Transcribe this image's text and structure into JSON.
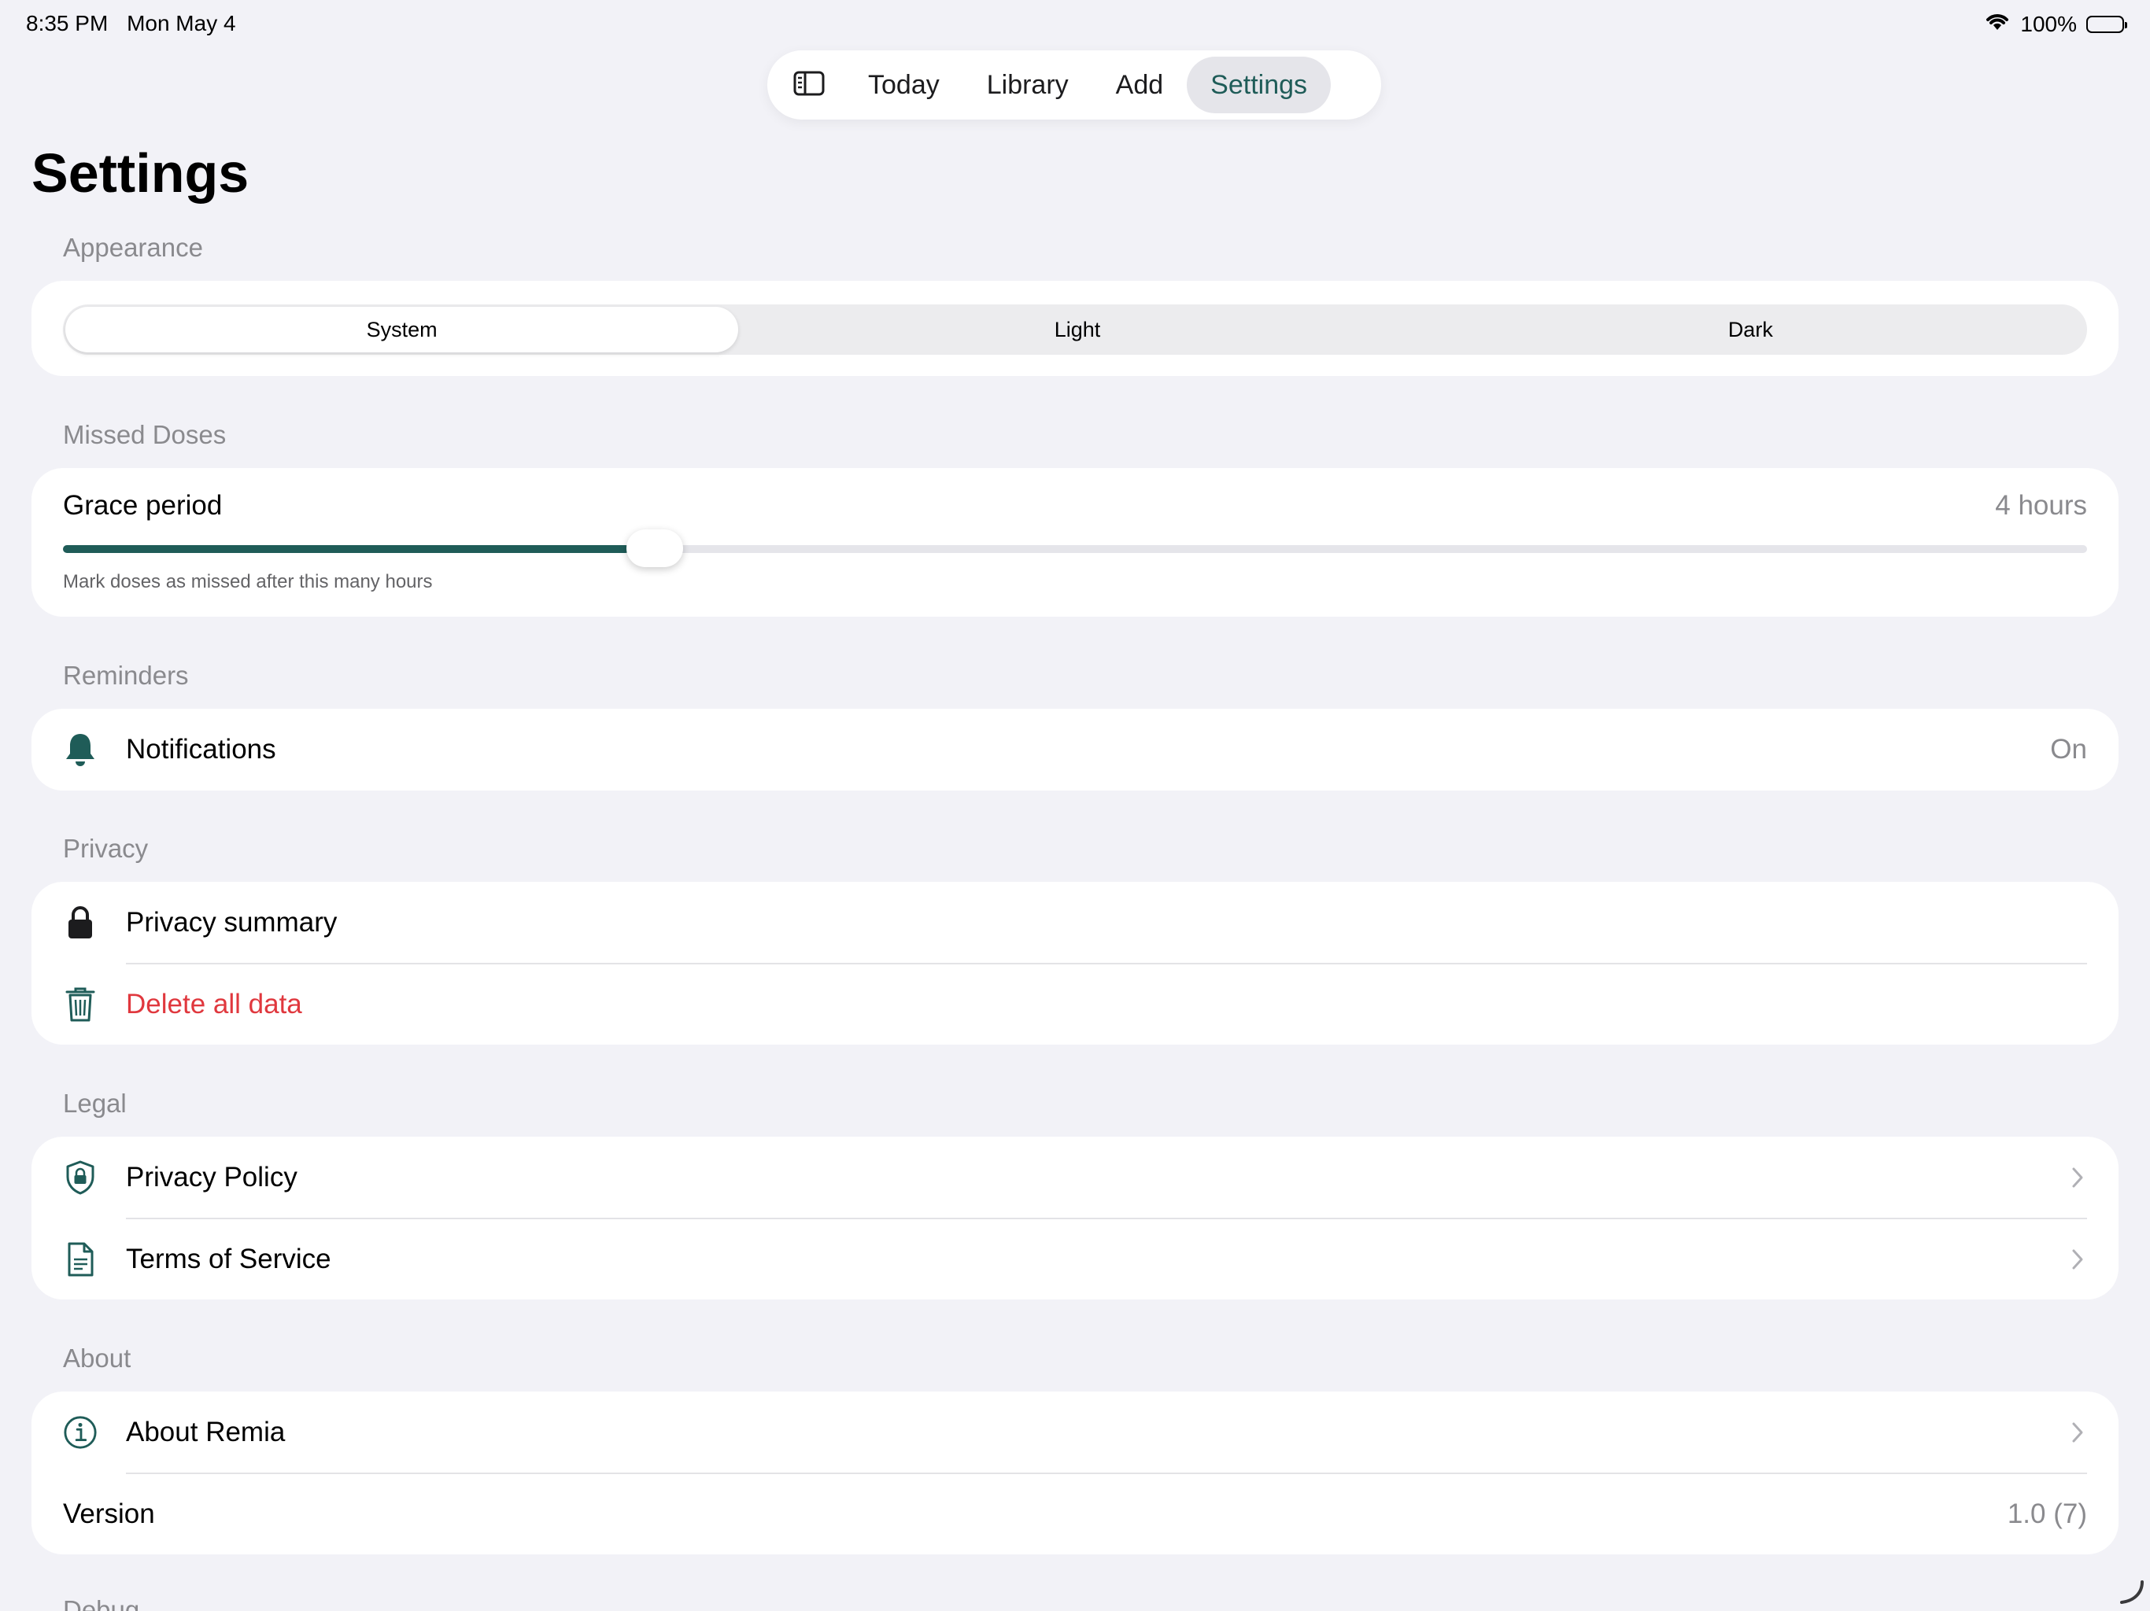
{
  "status_bar": {
    "time": "8:35 PM",
    "date": "Mon May 4",
    "battery": "100%"
  },
  "tabbar": {
    "tabs": [
      "Today",
      "Library",
      "Add",
      "Settings"
    ],
    "active": "Settings"
  },
  "page": {
    "title": "Settings"
  },
  "appearance": {
    "header": "Appearance",
    "options": [
      "System",
      "Light",
      "Dark"
    ],
    "selected": "System"
  },
  "missed_doses": {
    "header": "Missed Doses",
    "label": "Grace period",
    "value": "4 hours",
    "slider_fraction": 0.28,
    "caption": "Mark doses as missed after this many hours"
  },
  "reminders": {
    "header": "Reminders",
    "notifications_label": "Notifications",
    "notifications_value": "On"
  },
  "privacy": {
    "header": "Privacy",
    "summary_label": "Privacy summary",
    "delete_label": "Delete all data"
  },
  "legal": {
    "header": "Legal",
    "privacy_policy": "Privacy Policy",
    "terms": "Terms of Service"
  },
  "about": {
    "header": "About",
    "about_label": "About Remia",
    "version_label": "Version",
    "version_value": "1.0 (7)"
  },
  "next_section_header": "Debug",
  "colors": {
    "accent": "#1f5c58",
    "danger": "#e0383e",
    "background": "#f2f2f7",
    "secondary_text": "#8a8a8e"
  },
  "icons": {
    "sidebar": "sidebar-toggle-icon",
    "notifications": "bell-icon",
    "privacy_summary": "lock-icon",
    "delete": "trash-icon",
    "privacy_policy": "shield-lock-icon",
    "terms": "document-icon",
    "about": "info-circle-icon",
    "chevron": "chevron-right-icon"
  }
}
